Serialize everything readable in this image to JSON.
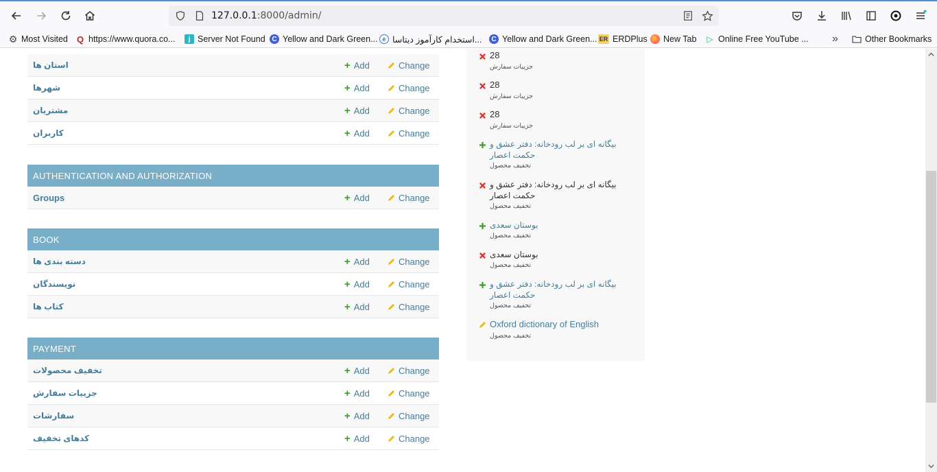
{
  "browser": {
    "url_host": "127.0.0.1",
    "url_rest": ":8000/admin/",
    "bookmarks": [
      {
        "label": "Most Visited",
        "icon": "gear-icon"
      },
      {
        "label": "https://www.quora.co...",
        "icon": "quora-icon"
      },
      {
        "label": "Server Not Found",
        "icon": "j-icon"
      },
      {
        "label": "Yellow and Dark Green...",
        "icon": "c-icon"
      },
      {
        "label": "استخدام کارآموز دیتاسا...",
        "icon": "e-icon"
      },
      {
        "label": "Yellow and Dark Green...",
        "icon": "c-icon"
      },
      {
        "label": "ERDPlus",
        "icon": "er-icon"
      },
      {
        "label": "New Tab",
        "icon": "firefox-icon"
      },
      {
        "label": "Online Free YouTube ...",
        "icon": "play-icon"
      }
    ],
    "overflow_label": "»",
    "other_bookmarks": "Other Bookmarks"
  },
  "common": {
    "add_label": "Add",
    "change_label": "Change"
  },
  "modules": {
    "partial": {
      "rows": [
        "استان ها",
        "شهرها",
        "مشتریان",
        "کاربران"
      ]
    },
    "auth": {
      "caption": "Authentication and Authorization",
      "rows": [
        "Groups"
      ]
    },
    "book": {
      "caption": "Book",
      "rows": [
        "دسته بندی ها",
        "نویسندگان",
        "کتاب ها"
      ]
    },
    "payment": {
      "caption": "Payment",
      "rows": [
        "تخفیف محصولات",
        "جزییات سفارش",
        "سفارشات",
        "کدهای تخفیف"
      ]
    }
  },
  "recent_actions": [
    {
      "action": "delete",
      "title": "28",
      "type": "جزییات سفارش"
    },
    {
      "action": "delete",
      "title": "28",
      "type": "جزییات سفارش"
    },
    {
      "action": "delete",
      "title": "28",
      "type": "جزییات سفارش"
    },
    {
      "action": "add",
      "title": "بیگانه ای بر لب رودخانه: دفتر عشق و حکمت اعصار",
      "type": "تخفیف محصول"
    },
    {
      "action": "delete",
      "title": "بیگانه ای بر لب رودخانه: دفتر عشق و حکمت اعصار",
      "type": "تخفیف محصول"
    },
    {
      "action": "add",
      "title": "بوستان سعدی",
      "type": "تخفیف محصول"
    },
    {
      "action": "delete",
      "title": "بوستان سعدی",
      "type": "تخفیف محصول"
    },
    {
      "action": "add",
      "title": "بیگانه ای بر لب رودخانه: دفتر عشق و حکمت اعصار",
      "type": "تخفیف محصول"
    },
    {
      "action": "change",
      "title": "Oxford dictionary of English",
      "type": "تخفیف محصول"
    }
  ],
  "colors": {
    "module_caption_bg": "#79aec8",
    "link": "#447e9b",
    "add_green": "#3d9a2b",
    "delete_red": "#d9322b",
    "change_yellow": "#efb80b"
  }
}
